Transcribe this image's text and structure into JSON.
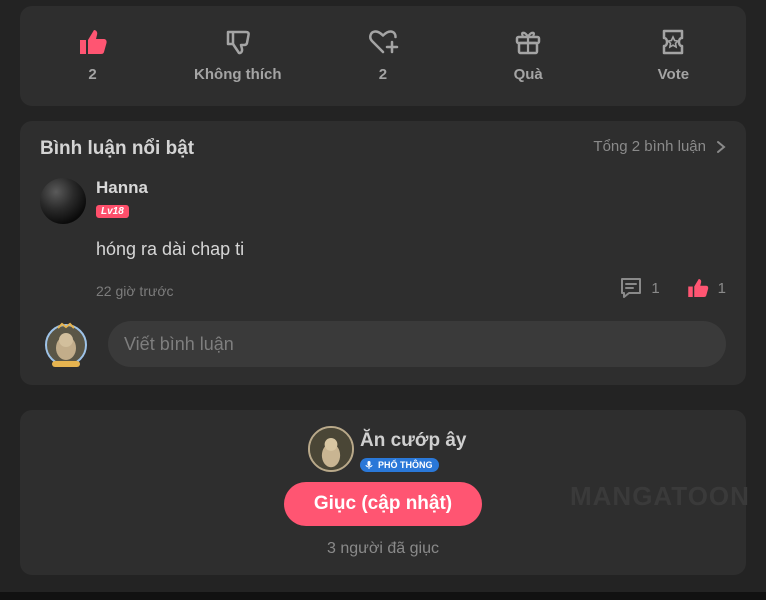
{
  "reactions": {
    "items": [
      {
        "icon": "thumbs-up-icon",
        "label": "2",
        "active": true
      },
      {
        "icon": "thumbs-down-icon",
        "label": "Không thích",
        "active": false
      },
      {
        "icon": "heart-plus-icon",
        "label": "2",
        "active": false
      },
      {
        "icon": "gift-icon",
        "label": "Quà",
        "active": false
      },
      {
        "icon": "vote-ticket-icon",
        "label": "Vote",
        "active": false
      }
    ],
    "accent": "#ff5572"
  },
  "comments": {
    "title": "Bình luận nổi bật",
    "total_label": "Tổng 2 bình luận",
    "items": [
      {
        "user": "Hanna",
        "level": "Lv18",
        "text": "hóng ra dài chap ti",
        "time": "22 giờ trước",
        "reply_count": "1",
        "like_count": "1"
      }
    ],
    "input_placeholder": "Viết bình luận"
  },
  "author": {
    "name": "Ăn cướp ây",
    "tier": "PHỔ THÔNG",
    "urge_button": "Giục (cập nhật)",
    "urge_count_text": "3 người đã giục",
    "watermark": "MANGATOON"
  },
  "colors": {
    "background": "#232323",
    "card": "#2e2e2e",
    "accent": "#ff5572",
    "tier_badge": "#2a78d8"
  }
}
